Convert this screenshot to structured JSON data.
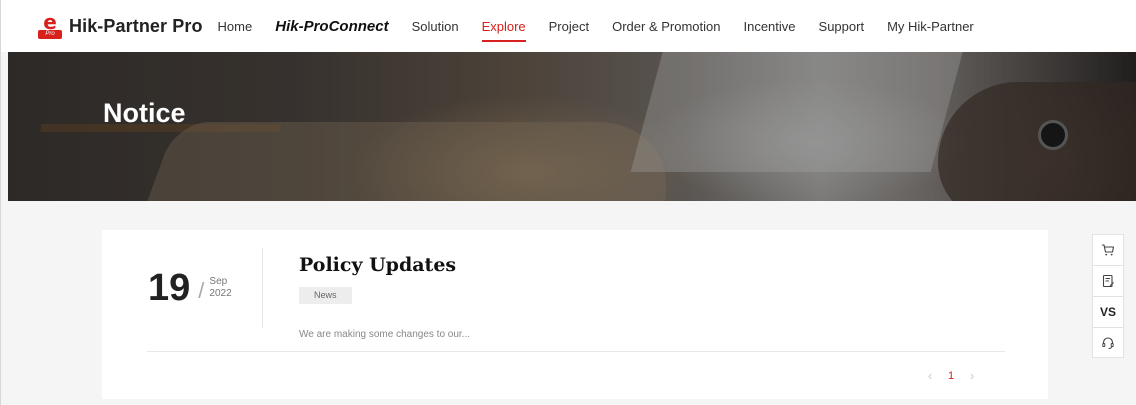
{
  "header": {
    "logo_badge_text": "Pro",
    "brand": "Hik-Partner Pro",
    "nav": [
      {
        "label": "Home"
      },
      {
        "label": "Hik-ProConnect"
      },
      {
        "label": "Solution"
      },
      {
        "label": "Explore",
        "active": true
      },
      {
        "label": "Project"
      },
      {
        "label": "Order & Promotion"
      },
      {
        "label": "Incentive"
      },
      {
        "label": "Support"
      },
      {
        "label": "My Hik-Partner"
      }
    ],
    "accent_color": "#d8201c"
  },
  "banner": {
    "title": "Notice"
  },
  "notice": {
    "day": "19",
    "slash": "/",
    "month": "Sep",
    "year": "2022",
    "title": "Policy Updates",
    "tag": "News",
    "excerpt": "We are making some changes to our..."
  },
  "pagination": {
    "prev": "‹",
    "current_page": "1",
    "next": "›"
  },
  "side_tools": [
    {
      "icon": "cart-icon"
    },
    {
      "icon": "edit-note-icon"
    },
    {
      "label": "VS",
      "icon": "compare-vs-icon"
    },
    {
      "icon": "headset-support-icon"
    }
  ]
}
